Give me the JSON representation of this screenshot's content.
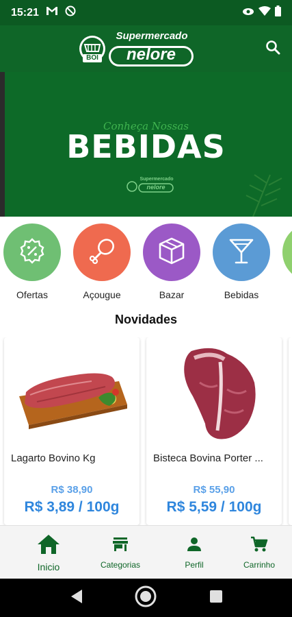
{
  "status_bar": {
    "time": "15:21",
    "left_icons": [
      "gmail-icon",
      "dnd-icon"
    ],
    "right_icons": [
      "eye-icon",
      "wifi-icon",
      "battery-icon"
    ]
  },
  "app_bar": {
    "logo_top": "Supermercado",
    "logo_main": "nelore",
    "logo_badge": "BOI",
    "search_icon": "search-icon"
  },
  "banner": {
    "script_text": "Conheça Nossas",
    "title": "BEBIDAS",
    "mini_logo_top": "Supermercado",
    "mini_logo_main": "nelore"
  },
  "categories": [
    {
      "label": "Ofertas",
      "icon": "discount-badge-icon",
      "color": "#6fbf73"
    },
    {
      "label": "Açougue",
      "icon": "chicken-leg-icon",
      "color": "#ef6a4f"
    },
    {
      "label": "Bazar",
      "icon": "box-icon",
      "color": "#9b59c6"
    },
    {
      "label": "Bebidas",
      "icon": "cocktail-glass-icon",
      "color": "#5b9bd5"
    }
  ],
  "section": {
    "title": "Novidades"
  },
  "products": [
    {
      "name": "Lagarto Bovino Kg",
      "old_price": "R$ 38,90",
      "price": "R$ 3,89 / 100g"
    },
    {
      "name": "Bisteca Bovina Porter ...",
      "old_price": "R$ 55,90",
      "price": "R$ 5,59 / 100g"
    }
  ],
  "bottom_nav": [
    {
      "label": "Inicio",
      "icon": "home-icon",
      "active": true
    },
    {
      "label": "Categorias",
      "icon": "store-icon",
      "active": false
    },
    {
      "label": "Perfil",
      "icon": "person-icon",
      "active": false
    },
    {
      "label": "Carrinho",
      "icon": "cart-icon",
      "active": false
    }
  ],
  "colors": {
    "brand_green": "#0f6628",
    "price_blue": "#2f86dd"
  }
}
